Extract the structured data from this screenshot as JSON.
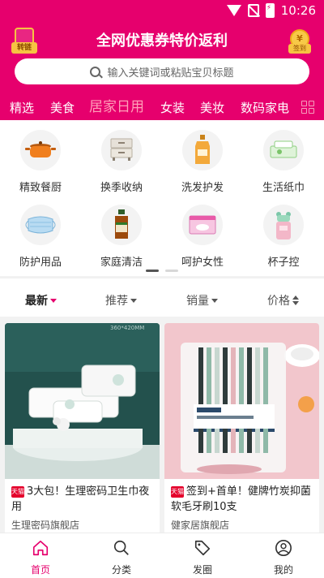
{
  "status_bar": {
    "time": "10:26"
  },
  "header": {
    "title": "全网优惠券特价返利",
    "left_badge": "转链",
    "right_badge": "签到",
    "search_placeholder": "输入关键词或粘贴宝贝标题",
    "tabs": [
      "精选",
      "美食",
      "居家日用",
      "女装",
      "美妆",
      "数码家电"
    ],
    "active_tab": "居家日用"
  },
  "categories": [
    {
      "label": "精致餐厨",
      "icon": "pot-icon"
    },
    {
      "label": "换季收纳",
      "icon": "storage-box-icon"
    },
    {
      "label": "洗发护发",
      "icon": "shampoo-icon"
    },
    {
      "label": "生活纸巾",
      "icon": "tissue-icon"
    },
    {
      "label": "防护用品",
      "icon": "mask-icon"
    },
    {
      "label": "家庭清洁",
      "icon": "disinfectant-icon"
    },
    {
      "label": "呵护女性",
      "icon": "sanitary-pad-icon"
    },
    {
      "label": "杯子控",
      "icon": "cup-icon"
    }
  ],
  "sort_bar": {
    "items": [
      "最新",
      "推荐",
      "销量",
      "价格"
    ],
    "active": "最新"
  },
  "products": [
    {
      "badge": "天猫",
      "title": "3大包！生理密码卫生巾夜用",
      "shop": "生理密码旗舰店",
      "image_caption": "360*420MM"
    },
    {
      "badge": "天猫",
      "title": "签到+首单！健牌竹炭抑菌软毛牙刷10支",
      "shop": "健家居旗舰店"
    }
  ],
  "bottom_nav": [
    {
      "label": "首页",
      "icon": "home-icon"
    },
    {
      "label": "分类",
      "icon": "search-icon"
    },
    {
      "label": "发圈",
      "icon": "tag-icon"
    },
    {
      "label": "我的",
      "icon": "user-icon"
    }
  ],
  "colors": {
    "brand": "#e6006d",
    "tab_active": "#ff9fb8"
  }
}
